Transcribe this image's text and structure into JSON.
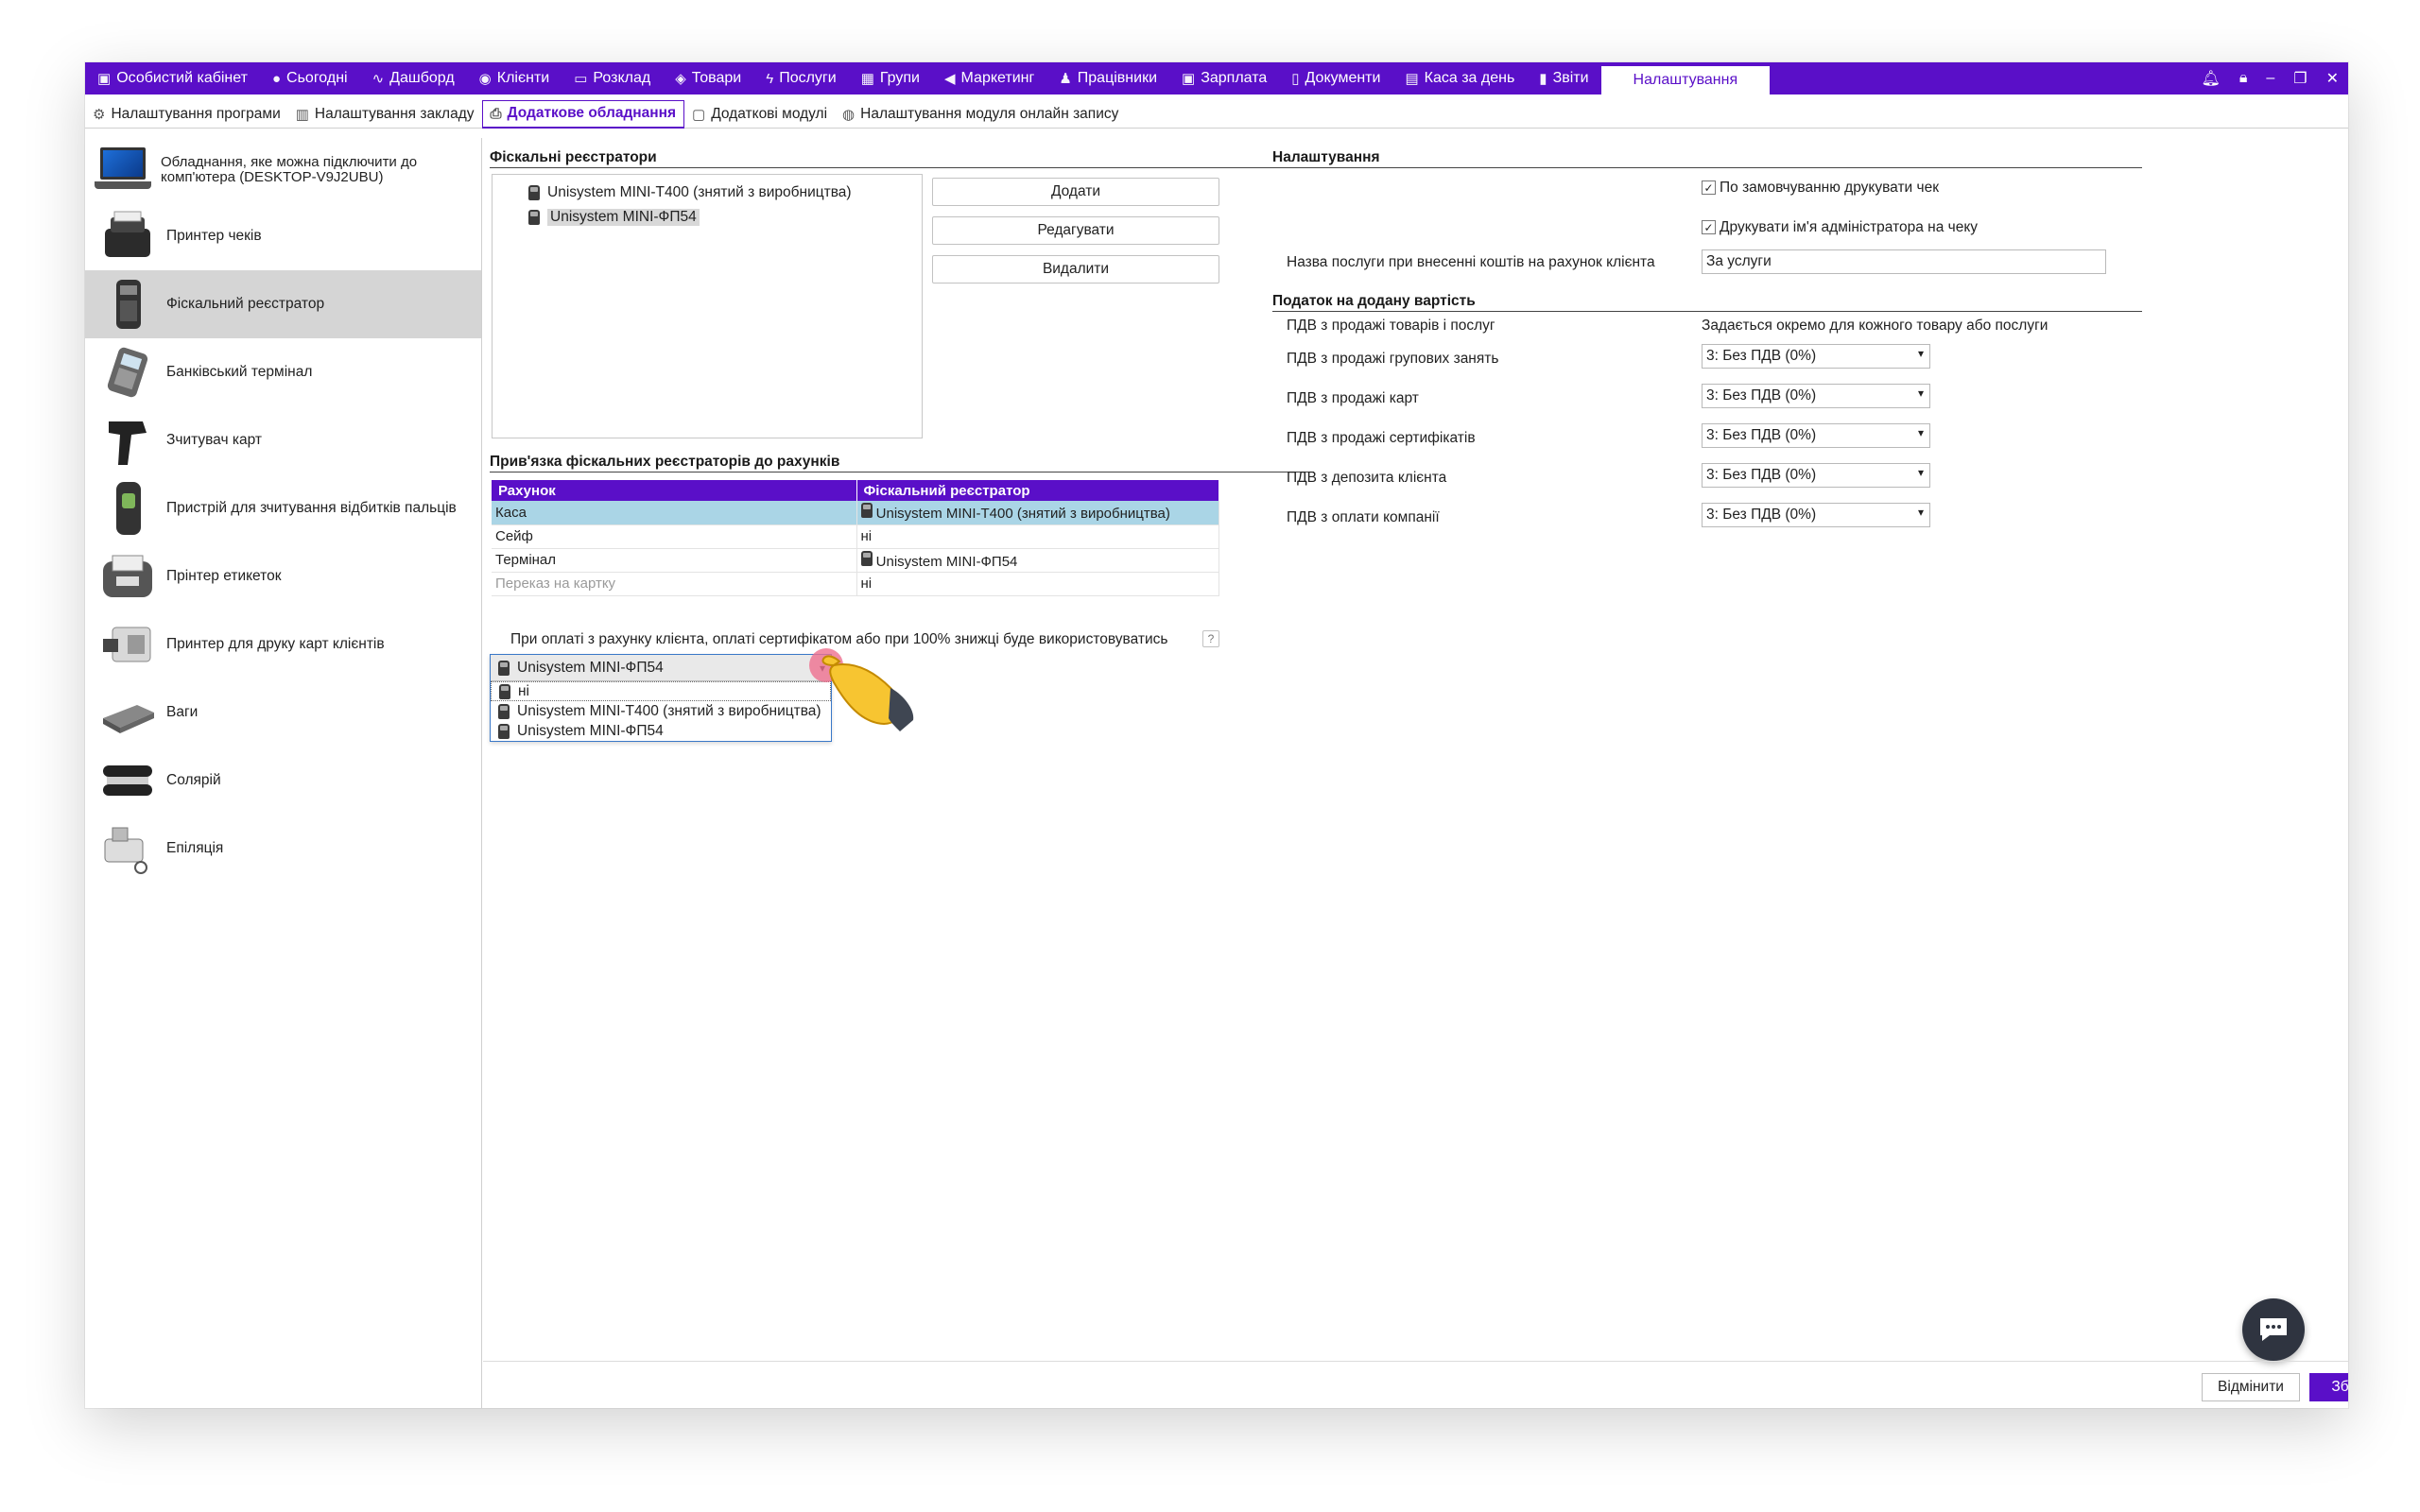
{
  "nav": {
    "items": [
      {
        "label": "Особистий кабінет",
        "icon": "wallet-icon"
      },
      {
        "label": "Сьогодні",
        "icon": "today-icon"
      },
      {
        "label": "Дашборд",
        "icon": "pulse-icon"
      },
      {
        "label": "Клієнти",
        "icon": "user-circle-icon"
      },
      {
        "label": "Розклад",
        "icon": "calendar-icon"
      },
      {
        "label": "Товари",
        "icon": "box-icon"
      },
      {
        "label": "Послуги",
        "icon": "lightning-icon"
      },
      {
        "label": "Групи",
        "icon": "groups-icon"
      },
      {
        "label": "Маркетинг",
        "icon": "megaphone-icon"
      },
      {
        "label": "Працівники",
        "icon": "person-icon"
      },
      {
        "label": "Зарплата",
        "icon": "money-icon"
      },
      {
        "label": "Документи",
        "icon": "document-icon"
      },
      {
        "label": "Каса за день",
        "icon": "calculator-icon"
      },
      {
        "label": "Звіти",
        "icon": "bar-chart-icon"
      }
    ],
    "active": "Налаштування"
  },
  "subtabs": [
    {
      "label": "Налаштування програми",
      "icon": "gear-icon"
    },
    {
      "label": "Налаштування закладу",
      "icon": "building-icon"
    },
    {
      "label": "Додаткове обладнання",
      "icon": "printer-icon",
      "active": true
    },
    {
      "label": "Додаткові модулі",
      "icon": "module-icon"
    },
    {
      "label": "Налаштування модуля онлайн запису",
      "icon": "globe-icon"
    }
  ],
  "left": {
    "header": "Обладнання, яке можна підключити до комп'ютера (DESKTOP-V9J2UBU)",
    "devices": [
      {
        "label": "Принтер чеків"
      },
      {
        "label": "Фіскальний реєстратор"
      },
      {
        "label": "Банківський термінал"
      },
      {
        "label": "Зчитувач карт"
      },
      {
        "label": "Пристрій для зчитування відбитків пальців"
      },
      {
        "label": "Прінтер етикеток"
      },
      {
        "label": "Принтер для друку карт клієнтів"
      },
      {
        "label": "Ваги"
      },
      {
        "label": "Солярій"
      },
      {
        "label": "Епіляція"
      }
    ]
  },
  "fiscal": {
    "title": "Фіскальні реєстратори",
    "items": [
      "Unisystem MINI-T400 (знятий з виробництва)",
      "Unisystem MINI-ФП54"
    ],
    "add": "Додати",
    "edit": "Редагувати",
    "delete": "Видалити"
  },
  "binding": {
    "title": "Прив'язка фіскальних реєстраторів до рахунків",
    "headers": [
      "Рахунок",
      "Фіскальний реєстратор"
    ],
    "rows": [
      [
        "Каса",
        "Unisystem MINI-T400 (знятий з виробництва)"
      ],
      [
        "Сейф",
        "ні"
      ],
      [
        "Термінал",
        "Unisystem MINI-ФП54"
      ],
      [
        "Переказ на картку",
        "ні"
      ]
    ],
    "note": "При оплаті з рахунку клієнта, оплаті сертифікатом або при 100% знижці буде використовуватись",
    "help": "?",
    "selected": "Unisystem MINI-ФП54",
    "options": [
      "ні",
      "Unisystem MINI-T400 (знятий з виробництва)",
      "Unisystem MINI-ФП54"
    ]
  },
  "settings": {
    "title": "Налаштування",
    "check1": "По замовчуванню друкувати чек",
    "check2": "Друкувати ім'я адміністратора на чеку",
    "service_label": "Назва послуги при внесенні коштів на рахунок клієнта",
    "service_value": "За услуги"
  },
  "vat": {
    "title": "Податок на додану вартість",
    "rows": [
      {
        "label": "ПДВ з продажі товарів і послуг",
        "value": "Задається окремо для кожного товару або послуги"
      },
      {
        "label": "ПДВ з продажі групових занять",
        "value": "3: Без ПДВ (0%)"
      },
      {
        "label": "ПДВ з продажі карт",
        "value": "3: Без ПДВ (0%)"
      },
      {
        "label": "ПДВ з продажі сертифікатів",
        "value": "3: Без ПДВ (0%)"
      },
      {
        "label": "ПДВ з депозита клієнта",
        "value": "3: Без ПДВ (0%)"
      },
      {
        "label": "ПДВ з оплати компанії",
        "value": "3: Без ПДВ (0%)"
      }
    ]
  },
  "footer": {
    "cancel": "Відмінити",
    "save": "Зберегти"
  },
  "colors": {
    "accent": "#5a0fc8",
    "highlight": "#aad5e6",
    "selected_device": "#d5d5d5"
  }
}
